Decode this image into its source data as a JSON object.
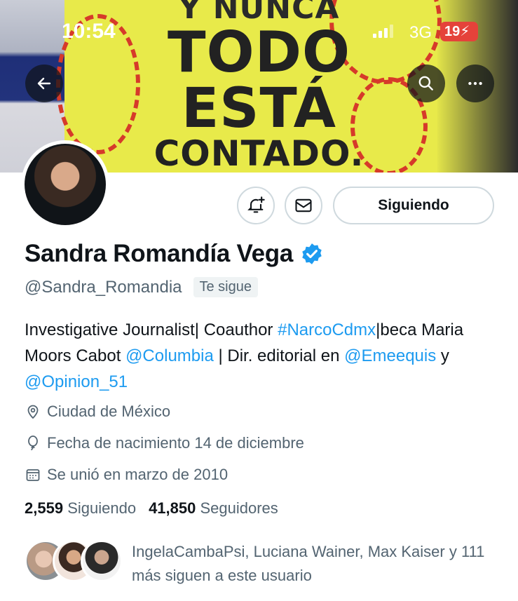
{
  "status_bar": {
    "time": "10:54",
    "network": "3G",
    "battery": "19"
  },
  "banner": {
    "line1": "Y NUNCA",
    "line2": "TODO",
    "line3": "ESTÁ",
    "line4": "CONTADO."
  },
  "profile": {
    "name": "Sandra Romandía Vega",
    "handle": "@Sandra_Romandia",
    "follows_you": "Te sigue",
    "following_button": "Siguiendo",
    "bio": {
      "t1": "Investigative Journalist| Coauthor ",
      "l1": "#NarcoCdmx",
      "t2": "|beca Maria Moors Cabot ",
      "l2": "@Columbia",
      "t3": " | Dir. editorial en ",
      "l3": "@Emeequis",
      "t4": " y ",
      "l4": "@Opinion_51"
    },
    "location": "Ciudad de México",
    "birthday": "Fecha de nacimiento 14 de diciembre",
    "joined": "Se unió en marzo de 2010",
    "following_count": "2,559",
    "following_label": "Siguiendo",
    "followers_count": "41,850",
    "followers_label": "Seguidores",
    "known_followers": "IngelaCambaPsi, Luciana Wainer, Max Kaiser y 111 más siguen a este usuario"
  },
  "colors": {
    "link": "#1d9bf0",
    "verified": "#1d9bf0",
    "battery": "#e5423a"
  }
}
